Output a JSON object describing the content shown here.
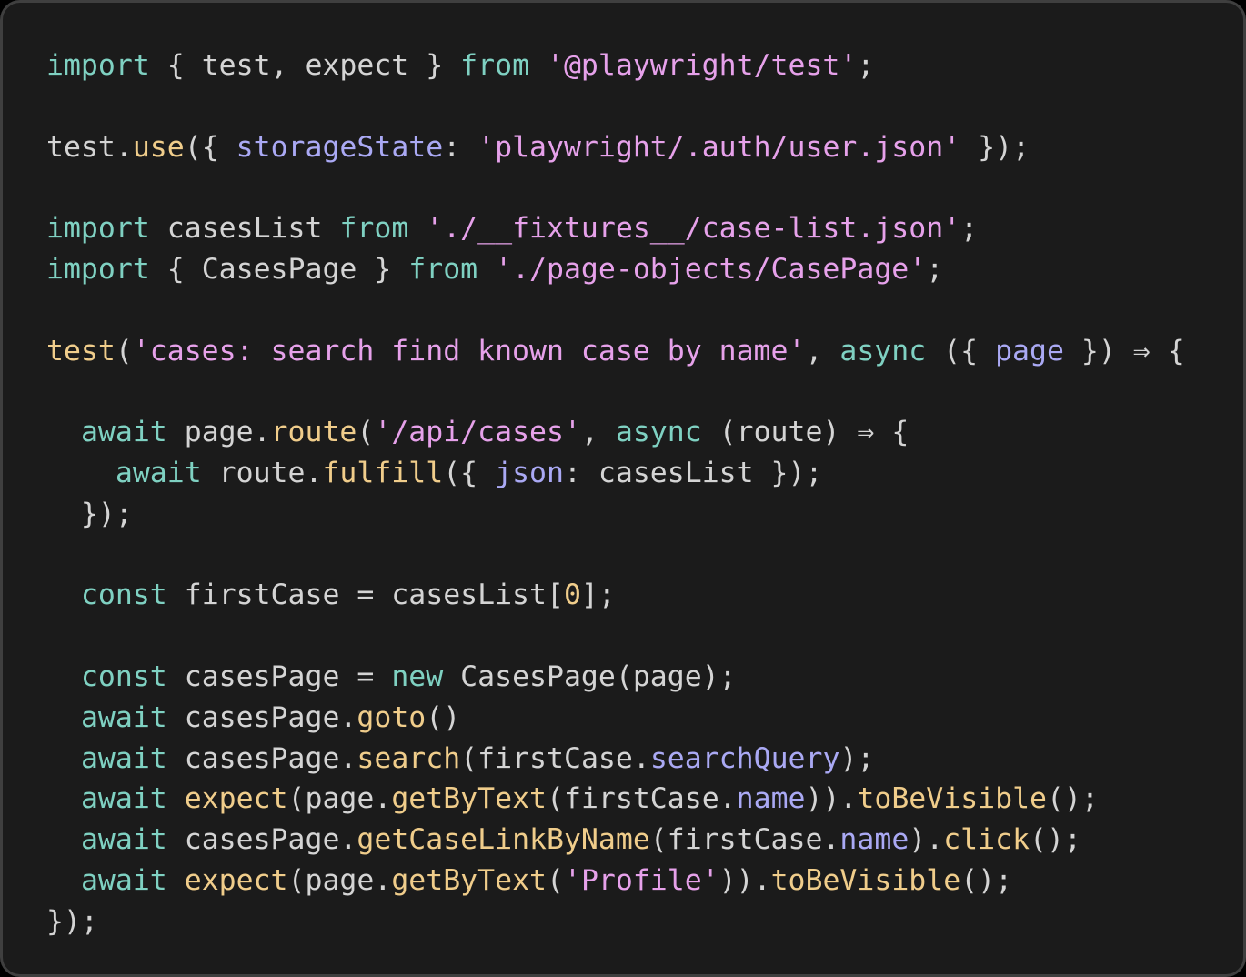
{
  "colors": {
    "default": "#d4d4d4",
    "keyword": "#7fd1c2",
    "string": "#e6a1ea",
    "function": "#f0cd8b",
    "property": "#aaa9f4",
    "number": "#f0cd8b",
    "background": "#1b1b1b",
    "border": "#3f3f3f"
  },
  "code_lines": [
    [
      [
        "kw",
        "import"
      ],
      [
        "d",
        " { test, expect } "
      ],
      [
        "kw",
        "from"
      ],
      [
        "d",
        " "
      ],
      [
        "str",
        "'@playwright/test'"
      ],
      [
        "d",
        ";"
      ]
    ],
    [],
    [
      [
        "d",
        "test."
      ],
      [
        "fn",
        "use"
      ],
      [
        "d",
        "({ "
      ],
      [
        "prop",
        "storageState"
      ],
      [
        "d",
        ": "
      ],
      [
        "str",
        "'playwright/.auth/user.json'"
      ],
      [
        "d",
        " });"
      ]
    ],
    [],
    [
      [
        "kw",
        "import"
      ],
      [
        "d",
        " casesList "
      ],
      [
        "kw",
        "from"
      ],
      [
        "d",
        " "
      ],
      [
        "str",
        "'./__fixtures__/case-list.json'"
      ],
      [
        "d",
        ";"
      ]
    ],
    [
      [
        "kw",
        "import"
      ],
      [
        "d",
        " { CasesPage } "
      ],
      [
        "kw",
        "from"
      ],
      [
        "d",
        " "
      ],
      [
        "str",
        "'./page-objects/CasePage'"
      ],
      [
        "d",
        ";"
      ]
    ],
    [],
    [
      [
        "fn",
        "test"
      ],
      [
        "d",
        "("
      ],
      [
        "str",
        "'cases: search find known case by name'"
      ],
      [
        "d",
        ", "
      ],
      [
        "kw",
        "async"
      ],
      [
        "d",
        " ({ "
      ],
      [
        "prop",
        "page"
      ],
      [
        "d",
        " }) ⇒ {"
      ]
    ],
    [],
    [
      [
        "d",
        "  "
      ],
      [
        "kw",
        "await"
      ],
      [
        "d",
        " page."
      ],
      [
        "fn",
        "route"
      ],
      [
        "d",
        "("
      ],
      [
        "str",
        "'/api/cases'"
      ],
      [
        "d",
        ", "
      ],
      [
        "kw",
        "async"
      ],
      [
        "d",
        " (route) ⇒ {"
      ]
    ],
    [
      [
        "d",
        "    "
      ],
      [
        "kw",
        "await"
      ],
      [
        "d",
        " route."
      ],
      [
        "fn",
        "fulfill"
      ],
      [
        "d",
        "({ "
      ],
      [
        "prop",
        "json"
      ],
      [
        "d",
        ": casesList });"
      ]
    ],
    [
      [
        "d",
        "  });"
      ]
    ],
    [],
    [
      [
        "d",
        "  "
      ],
      [
        "kw",
        "const"
      ],
      [
        "d",
        " firstCase = casesList["
      ],
      [
        "num",
        "0"
      ],
      [
        "d",
        "];"
      ]
    ],
    [],
    [
      [
        "d",
        "  "
      ],
      [
        "kw",
        "const"
      ],
      [
        "d",
        " casesPage = "
      ],
      [
        "kw",
        "new"
      ],
      [
        "d",
        " CasesPage(page);"
      ]
    ],
    [
      [
        "d",
        "  "
      ],
      [
        "kw",
        "await"
      ],
      [
        "d",
        " casesPage."
      ],
      [
        "fn",
        "goto"
      ],
      [
        "d",
        "()"
      ]
    ],
    [
      [
        "d",
        "  "
      ],
      [
        "kw",
        "await"
      ],
      [
        "d",
        " casesPage."
      ],
      [
        "fn",
        "search"
      ],
      [
        "d",
        "(firstCase."
      ],
      [
        "prop",
        "searchQuery"
      ],
      [
        "d",
        ");"
      ]
    ],
    [
      [
        "d",
        "  "
      ],
      [
        "kw",
        "await"
      ],
      [
        "d",
        " "
      ],
      [
        "fn",
        "expect"
      ],
      [
        "d",
        "(page."
      ],
      [
        "fn",
        "getByText"
      ],
      [
        "d",
        "(firstCase."
      ],
      [
        "prop",
        "name"
      ],
      [
        "d",
        "))."
      ],
      [
        "fn",
        "toBeVisible"
      ],
      [
        "d",
        "();"
      ]
    ],
    [
      [
        "d",
        "  "
      ],
      [
        "kw",
        "await"
      ],
      [
        "d",
        " casesPage."
      ],
      [
        "fn",
        "getCaseLinkByName"
      ],
      [
        "d",
        "(firstCase."
      ],
      [
        "prop",
        "name"
      ],
      [
        "d",
        ")."
      ],
      [
        "fn",
        "click"
      ],
      [
        "d",
        "();"
      ]
    ],
    [
      [
        "d",
        "  "
      ],
      [
        "kw",
        "await"
      ],
      [
        "d",
        " "
      ],
      [
        "fn",
        "expect"
      ],
      [
        "d",
        "(page."
      ],
      [
        "fn",
        "getByText"
      ],
      [
        "d",
        "("
      ],
      [
        "str",
        "'Profile'"
      ],
      [
        "d",
        "))."
      ],
      [
        "fn",
        "toBeVisible"
      ],
      [
        "d",
        "();"
      ]
    ],
    [
      [
        "d",
        "});"
      ]
    ]
  ]
}
